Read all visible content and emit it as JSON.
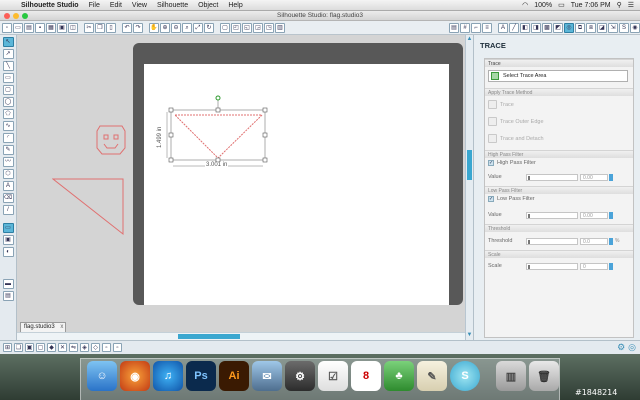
{
  "menubar": {
    "apple_glyph": "",
    "items": [
      "Silhouette Studio",
      "File",
      "Edit",
      "View",
      "Silhouette",
      "Object",
      "Help"
    ],
    "battery": "100%",
    "clock": "Tue 7:06 PM"
  },
  "window": {
    "title": "Silhouette Studio: flag.studio3"
  },
  "document": {
    "tab_label": "flag.studio3",
    "tab_close": "x"
  },
  "canvas": {
    "width_label": "3.001 in",
    "height_label": "1.499 in"
  },
  "panel": {
    "title": "TRACE",
    "sections": {
      "trace": "Trace",
      "apply": "Apply Trace Method",
      "high_pass": "High Pass Filter",
      "low_pass": "Low Pass Filter",
      "threshold": "Threshold",
      "scale": "Scale"
    },
    "select_area_label": "Select Trace Area",
    "methods": [
      "Trace",
      "Trace Outer Edge",
      "Trace and Detach"
    ],
    "high_pass_check": "High Pass Filter",
    "low_pass_check": "Low Pass Filter",
    "value_label": "Value",
    "value_high": "0.00",
    "value_low": "0.00",
    "threshold_label": "Threshold",
    "threshold_value": "0.0",
    "threshold_unit": "%",
    "scale_label": "Scale",
    "scale_value": "0"
  },
  "dock": {
    "ps_label": "Ps",
    "ai_label": "Ai",
    "cal_day": "8"
  },
  "watermark": "#1848214",
  "colors": {
    "accent": "#3aa7d0",
    "shape_stroke": "#e07070",
    "mat": "#585858"
  }
}
